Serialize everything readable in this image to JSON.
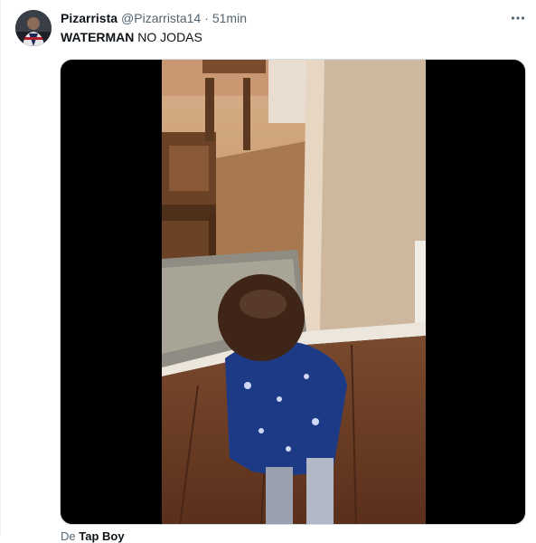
{
  "tweet": {
    "display_name": "Pizarrista",
    "handle": "@Pizarrista14",
    "separator": "·",
    "time": "51min",
    "text_bold": "WATERMAN",
    "text_rest": " NO JODAS",
    "attribution_prefix": "De ",
    "attribution_name": "Tap Boy"
  },
  "icons": {
    "more": "more-horizontal-icon",
    "avatar": "avatar-image"
  },
  "colors": {
    "text": "#0f1419",
    "secondary": "#536471",
    "media_bg": "#000000"
  }
}
